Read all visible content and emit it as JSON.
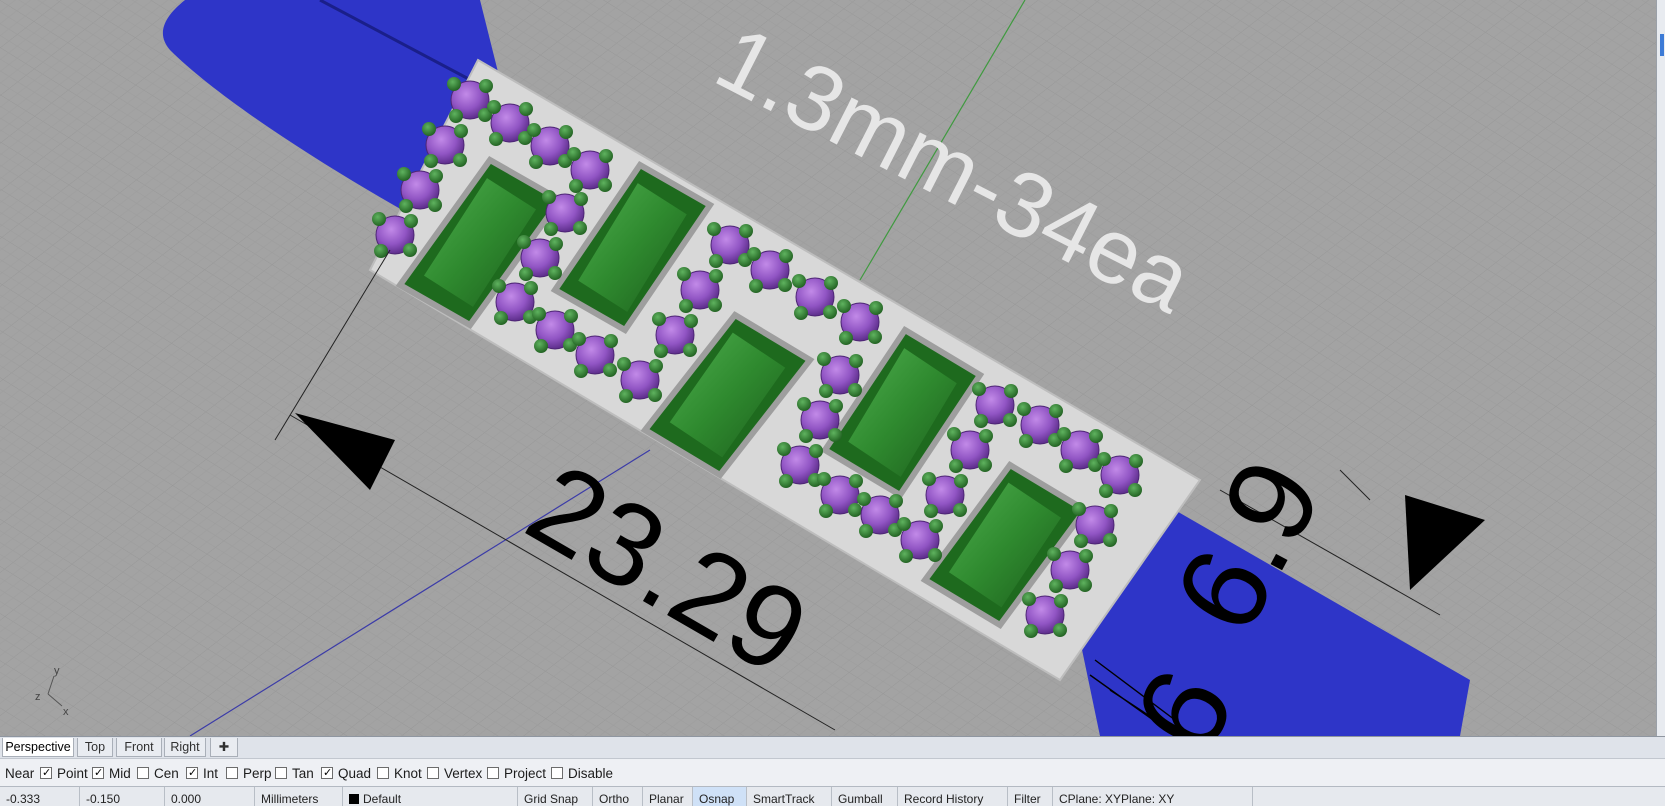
{
  "viewport": {
    "annotation_count": "1.3mm-34ea",
    "dim_length": "23.29",
    "dim_width": "6.9",
    "dim_partial": "6",
    "axes": {
      "y": "y",
      "z": "z",
      "x": "x"
    }
  },
  "tabs": [
    {
      "label": "Perspective",
      "active": true
    },
    {
      "label": "Top",
      "active": false
    },
    {
      "label": "Front",
      "active": false
    },
    {
      "label": "Right",
      "active": false
    }
  ],
  "add_tab_icon": "plus-icon",
  "snap_label": "Near",
  "osnaps": [
    {
      "label": "Point",
      "checked": true
    },
    {
      "label": "Mid",
      "checked": true
    },
    {
      "label": "Cen",
      "checked": false
    },
    {
      "label": "Int",
      "checked": true
    },
    {
      "label": "Perp",
      "checked": false
    },
    {
      "label": "Tan",
      "checked": false
    },
    {
      "label": "Quad",
      "checked": true
    },
    {
      "label": "Knot",
      "checked": false
    },
    {
      "label": "Vertex",
      "checked": false
    },
    {
      "label": "Project",
      "checked": false
    },
    {
      "label": "Disable",
      "checked": false
    }
  ],
  "status": {
    "x": "-0.333",
    "y": "-0.150",
    "z": "0.000",
    "units": "Millimeters",
    "layer": "Default",
    "grid_snap": "Grid Snap",
    "ortho": "Ortho",
    "planar": "Planar",
    "osnap": "Osnap",
    "smarttrack": "SmartTrack",
    "gumball": "Gumball",
    "record_history": "Record History",
    "filter": "Filter",
    "cplane": "CPlane: XYPlane: XY"
  },
  "colors": {
    "band": "#2e35c8",
    "gem_green": "#2e8a2e",
    "stone_purple": "#8a4fc0",
    "viewport_bg": "#a3a3a3",
    "tab_bg": "#dfe3ea"
  }
}
